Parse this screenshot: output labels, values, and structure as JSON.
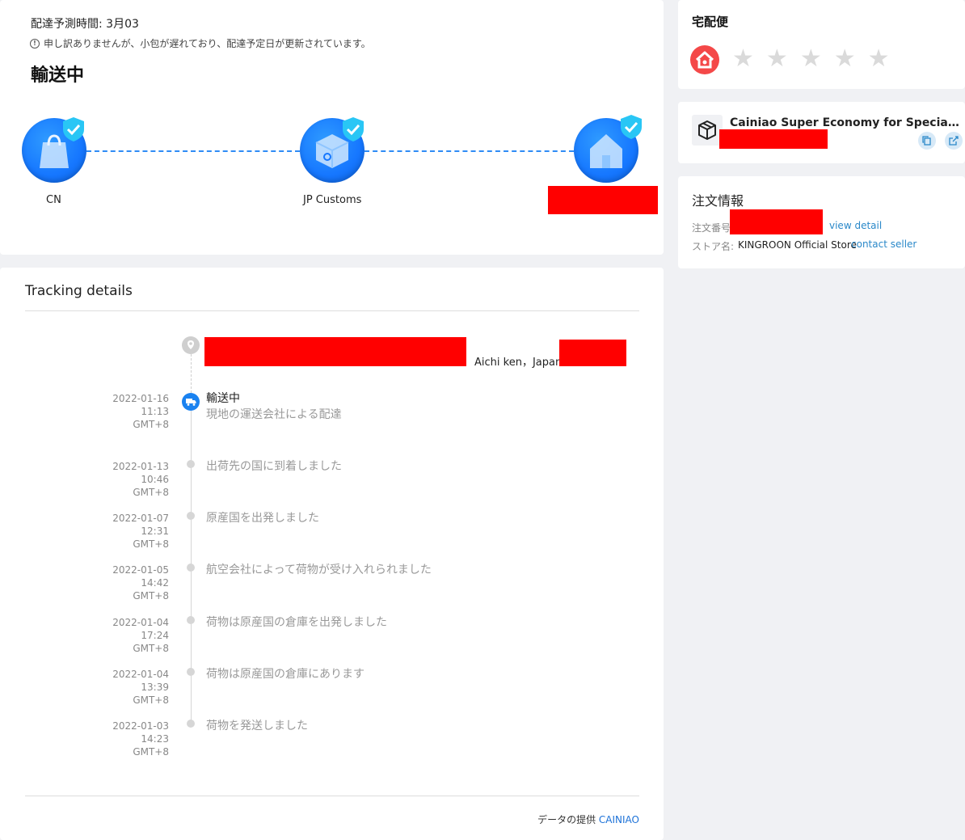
{
  "status": {
    "estimate": "配達予測時間: 3月03",
    "notice": "申し訳ありませんが、小包が遅れており、配達予定日が更新されています。",
    "title": "輸送中",
    "steps": [
      {
        "label": "CN"
      },
      {
        "label": "JP Customs"
      },
      {
        "label": ""
      }
    ]
  },
  "tracking": {
    "title": "Tracking details",
    "address_suffix": "Aichi ken，Japan",
    "events": [
      {
        "time": "2022-01-16 11:13",
        "tz": "GMT+8",
        "title": "輸送中",
        "detail": "現地の運送会社による配達"
      },
      {
        "time": "2022-01-13 10:46",
        "tz": "GMT+8",
        "detail": "出荷先の国に到着しました"
      },
      {
        "time": "2022-01-07 12:31",
        "tz": "GMT+8",
        "detail": "原産国を出発しました"
      },
      {
        "time": "2022-01-05 14:42",
        "tz": "GMT+8",
        "detail": "航空会社によって荷物が受け入れられました"
      },
      {
        "time": "2022-01-04 17:24",
        "tz": "GMT+8",
        "detail": "荷物は原産国の倉庫を出発しました"
      },
      {
        "time": "2022-01-04 13:39",
        "tz": "GMT+8",
        "detail": "荷物は原産国の倉庫にあります"
      },
      {
        "time": "2022-01-03 14:23",
        "tz": "GMT+8",
        "detail": "荷物を発送しました"
      }
    ],
    "footer_prefix": "データの提供",
    "footer_link": "CAINIAO"
  },
  "carrier": {
    "title": "宅配便",
    "rating": 0,
    "max_rating": 5
  },
  "service": {
    "name": "Cainiao Super Economy for Special Goods"
  },
  "order": {
    "title": "注文情報",
    "number_label": "注文番号",
    "view_detail": "view detail",
    "store_label": "ストア名:",
    "store_name": "KINGROON Official Store",
    "contact_seller": "contact seller"
  },
  "colors": {
    "accent": "#1677ff",
    "link": "#2a88c9",
    "carrier": "#f44848",
    "redaction": "#ff0000"
  }
}
